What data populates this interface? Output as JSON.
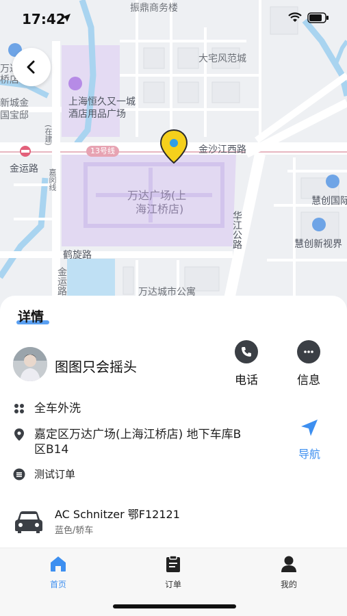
{
  "status": {
    "time": "17:42"
  },
  "map": {
    "labels": {
      "building_top": "振鼎商务楼",
      "residence": "大宅风范城",
      "wanda_left": "万达",
      "bridge_left": "桥店",
      "xincheng": "新城金",
      "guobao": "国宝邸",
      "hengjiu": "上海恒久又一城",
      "hengjiu2": "酒店用品广场",
      "metro_line": "13号线",
      "jinsha": "金沙江西路",
      "jinyun": "金运路",
      "zaijian": "(在建)",
      "jiamin": "嘉闵线",
      "wanda_plaza": "万达广场(上",
      "wanda_plaza2": "海江桥店)",
      "huichuang": "慧创国际",
      "huajiang": "华江公路",
      "huichuang_new": "慧创新视界",
      "hexuan": "鹤旋路",
      "jinyun2": "金运路",
      "apartment": "万达城市公寓"
    }
  },
  "sheet": {
    "title": "详情",
    "user_name": "图图只会摇头",
    "call_label": "电话",
    "message_label": "信息",
    "service": "全车外洗",
    "address": "嘉定区万达广场(上海江桥店) 地下车库B区B14",
    "address_line1": "嘉定区万达广场(上海江桥店) 地下车库B",
    "address_line2": "区B14",
    "note": "测试订单",
    "navigate_label": "导航",
    "car_name": "AC Schnitzer 鄂F12121",
    "car_desc": "蓝色/轿车"
  },
  "tabbar": {
    "home": "首页",
    "orders": "订单",
    "mine": "我的"
  },
  "colors": {
    "accent": "#3d8ff0",
    "pin": "#f5d01c",
    "dark_icon": "#3b3f45"
  }
}
